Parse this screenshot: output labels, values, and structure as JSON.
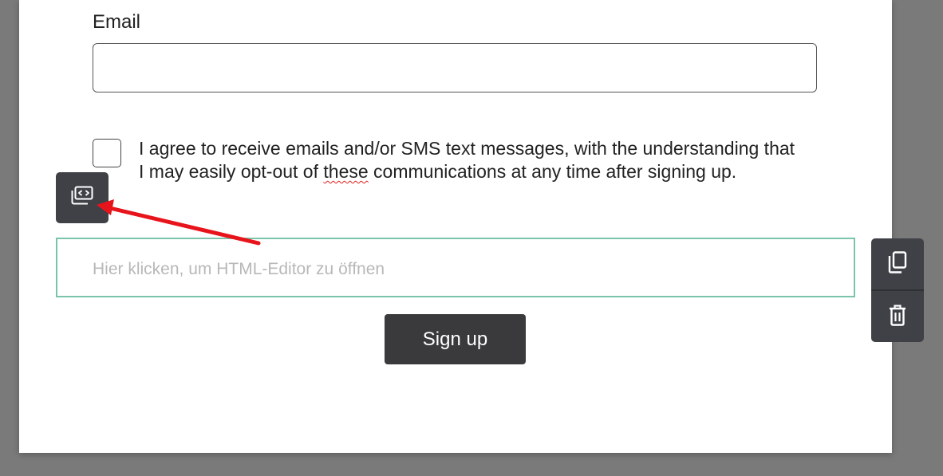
{
  "form": {
    "email_label": "Email",
    "email_value": "",
    "consent_text_before": "I agree to receive emails and/or SMS text messages, with the understanding that I may easily opt-out of ",
    "consent_text_flagged": "these",
    "consent_text_after": " communications at any time after signing up.",
    "consent_checked": false,
    "html_block_placeholder": "Hier klicken, um HTML-Editor zu öffnen",
    "signup_label": "Sign up"
  },
  "toolbars": {
    "left": [
      "code-editor-icon"
    ],
    "right": [
      "copy-icon",
      "trash-icon"
    ]
  },
  "colors": {
    "button_bg": "#3a3a3c",
    "toolbar_bg": "#3f4147",
    "html_block_border": "#7cc4a9",
    "annotation_arrow": "#e8141b",
    "page_backdrop": "#7a7a7a"
  }
}
